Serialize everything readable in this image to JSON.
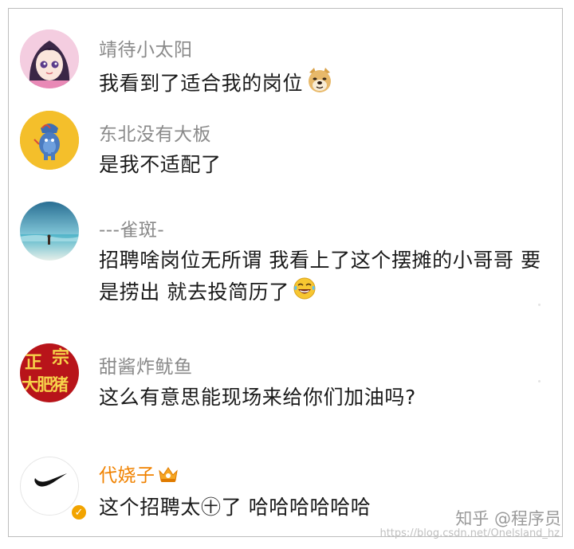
{
  "comments": [
    {
      "name": "靖待小太阳",
      "text": "我看到了适合我的岗位",
      "emoji": "doge-emoji"
    },
    {
      "name": "东北没有大板",
      "text": "是我不适配了"
    },
    {
      "name": "---雀斑-",
      "text": "招聘啥岗位无所谓 我看上了这个摆摊的小哥哥 要是捞出 就去投简历了",
      "emoji": "laugh-cry-emoji"
    },
    {
      "name": "甜酱炸鱿鱼",
      "text": "这么有意思能现场来给你们加油吗?",
      "avatar_text": [
        "正",
        "宗",
        "大肥猪"
      ]
    },
    {
      "name": "代娆子",
      "text_before": "这个招聘太",
      "emoji_inline": "㊉",
      "text_after": "了  哈哈哈哈哈哈",
      "vip": true
    }
  ],
  "watermark": {
    "brand": "知乎 @程序员",
    "url": "https://blog.csdn.net/Onelsland_hz"
  },
  "colors": {
    "name_gray": "#8a8a8a",
    "vip_orange": "#f08200",
    "text": "#1a1a1a"
  }
}
